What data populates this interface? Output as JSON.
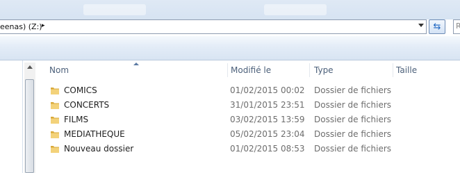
{
  "address_bar": {
    "path_text": "eenas) (Z:)",
    "separator": "▸"
  },
  "search": {
    "placeholder": "R"
  },
  "columns": {
    "name": "Nom",
    "modified": "Modifié le",
    "type": "Type",
    "size": "Taille"
  },
  "files": [
    {
      "name": "COMICS",
      "modified": "01/02/2015 00:02",
      "type": "Dossier de fichiers",
      "icon": "folder-icon"
    },
    {
      "name": "CONCERTS",
      "modified": "31/01/2015 23:51",
      "type": "Dossier de fichiers",
      "icon": "folder-icon"
    },
    {
      "name": "FILMS",
      "modified": "03/02/2015 13:59",
      "type": "Dossier de fichiers",
      "icon": "folder-icon"
    },
    {
      "name": "MEDIATHEQUE",
      "modified": "05/02/2015 23:04",
      "type": "Dossier de fichiers",
      "icon": "folder-icon"
    },
    {
      "name": "Nouveau dossier",
      "modified": "01/02/2015 08:53",
      "type": "Dossier de fichiers",
      "icon": "folder-icon"
    }
  ],
  "colors": {
    "folder": "#e8c25a",
    "header_text": "#4c607a",
    "secondary_text": "#6d6d6d"
  }
}
